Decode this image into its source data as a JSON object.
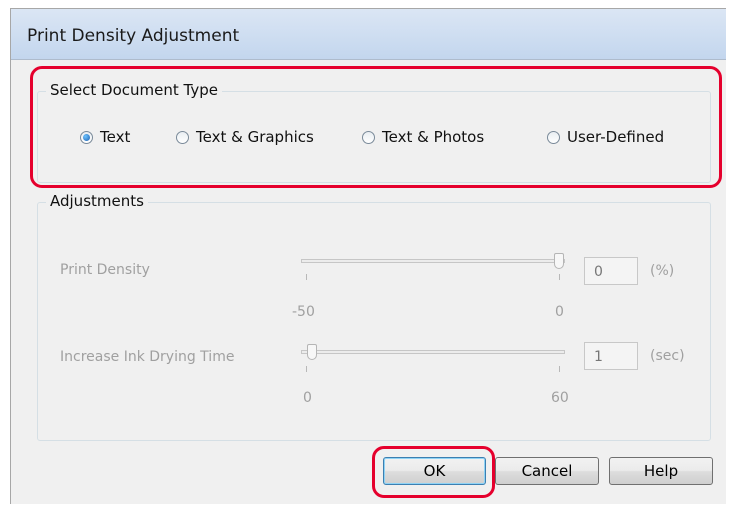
{
  "dialog": {
    "title": "Print Density Adjustment"
  },
  "document_type": {
    "legend": "Select Document Type",
    "options": [
      {
        "label": "Text",
        "selected": true
      },
      {
        "label": "Text & Graphics",
        "selected": false
      },
      {
        "label": "Text & Photos",
        "selected": false
      },
      {
        "label": "User-Defined",
        "selected": false
      }
    ]
  },
  "adjustments": {
    "legend": "Adjustments",
    "print_density": {
      "label": "Print Density",
      "value": "0",
      "unit": "(%)",
      "min_label": "-50",
      "max_label": "0",
      "min": -50,
      "max": 0
    },
    "drying_time": {
      "label": "Increase Ink Drying Time",
      "value": "1",
      "unit": "(sec)",
      "min_label": "0",
      "max_label": "60",
      "min": 0,
      "max": 60
    }
  },
  "buttons": {
    "ok": "OK",
    "cancel": "Cancel",
    "help": "Help"
  },
  "colors": {
    "highlight": "#e5002d",
    "disabled_text": "#a0a0a0"
  }
}
